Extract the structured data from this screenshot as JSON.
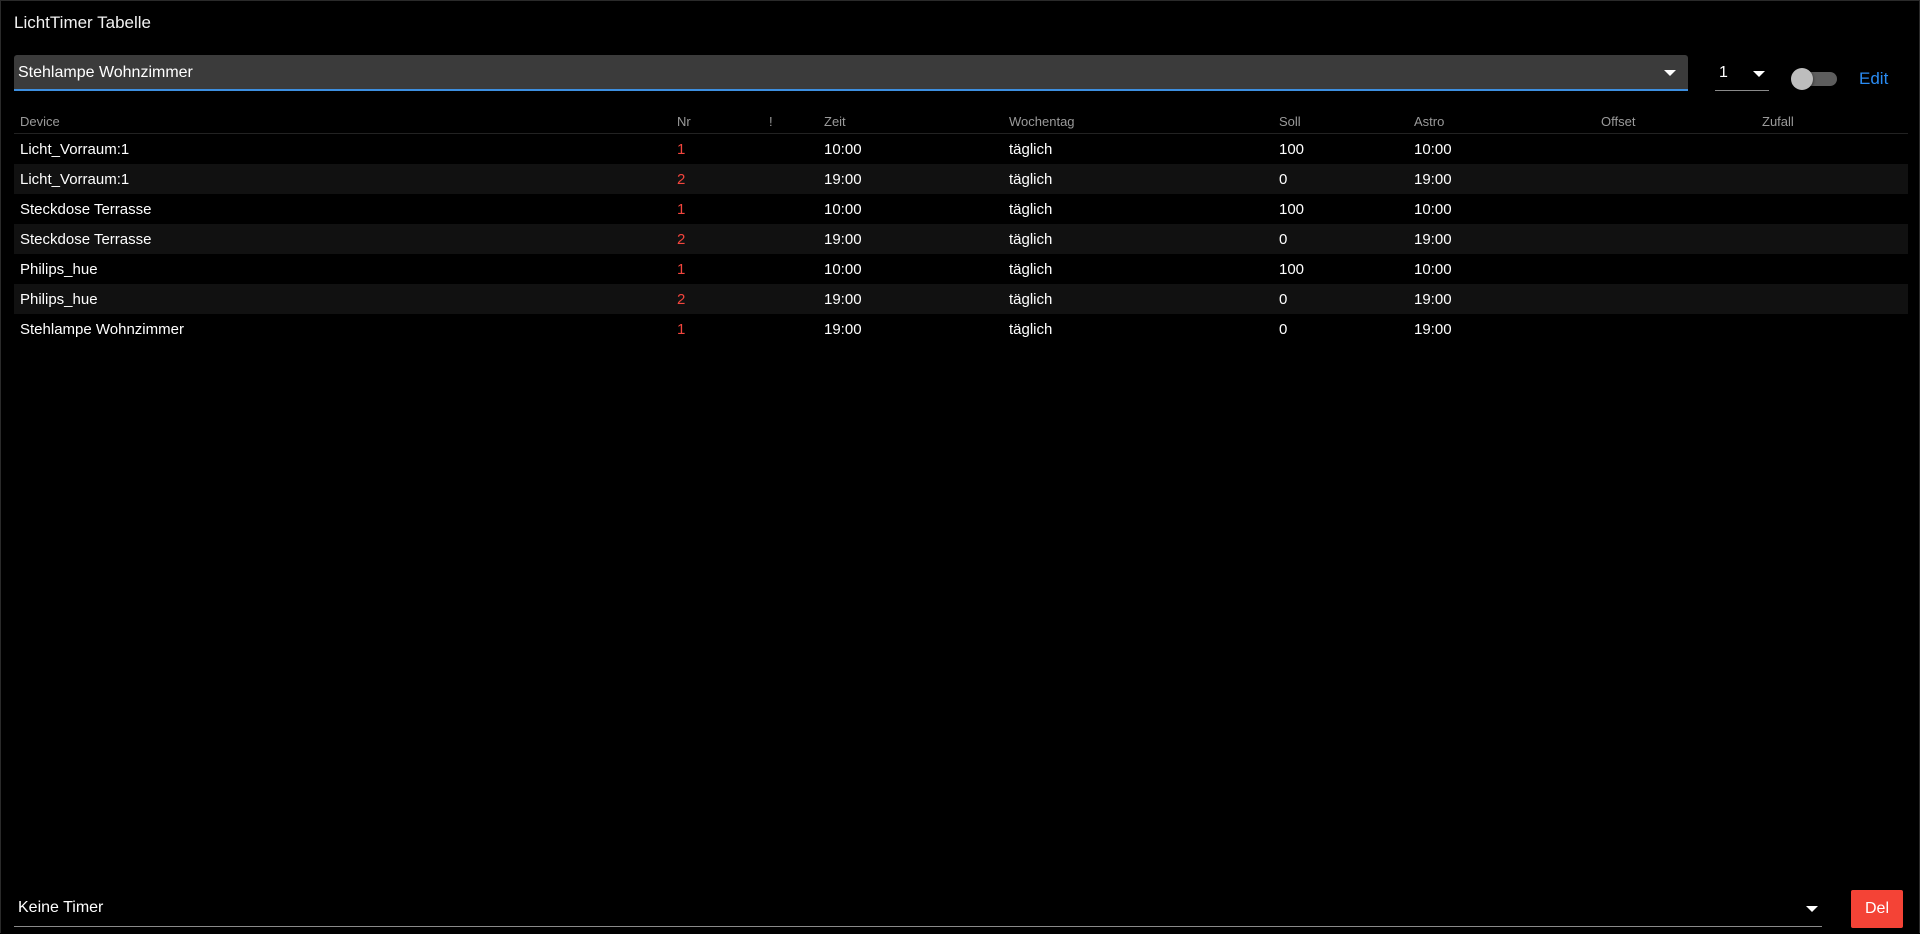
{
  "header": {
    "title": "LichtTimer Tabelle",
    "device_select_value": "Stehlampe Wohnzimmer",
    "number_select_value": "1",
    "edit_label": "Edit",
    "toggle_on": false
  },
  "table": {
    "columns": [
      "Device",
      "Nr",
      "!",
      "Zeit",
      "Wochentag",
      "Soll",
      "Astro",
      "Offset",
      "Zufall"
    ],
    "rows": [
      {
        "device": "Licht_Vorraum:1",
        "nr": "1",
        "excl": "",
        "zeit": "10:00",
        "wochentag": "täglich",
        "soll": "100",
        "astro": "10:00",
        "offset": "",
        "zufall": ""
      },
      {
        "device": "Licht_Vorraum:1",
        "nr": "2",
        "excl": "",
        "zeit": "19:00",
        "wochentag": "täglich",
        "soll": "0",
        "astro": "19:00",
        "offset": "",
        "zufall": ""
      },
      {
        "device": "Steckdose Terrasse",
        "nr": "1",
        "excl": "",
        "zeit": "10:00",
        "wochentag": "täglich",
        "soll": "100",
        "astro": "10:00",
        "offset": "",
        "zufall": ""
      },
      {
        "device": "Steckdose Terrasse",
        "nr": "2",
        "excl": "",
        "zeit": "19:00",
        "wochentag": "täglich",
        "soll": "0",
        "astro": "19:00",
        "offset": "",
        "zufall": ""
      },
      {
        "device": "Philips_hue",
        "nr": "1",
        "excl": "",
        "zeit": "10:00",
        "wochentag": "täglich",
        "soll": "100",
        "astro": "10:00",
        "offset": "",
        "zufall": ""
      },
      {
        "device": "Philips_hue",
        "nr": "2",
        "excl": "",
        "zeit": "19:00",
        "wochentag": "täglich",
        "soll": "0",
        "astro": "19:00",
        "offset": "",
        "zufall": ""
      },
      {
        "device": "Stehlampe Wohnzimmer",
        "nr": "1",
        "excl": "",
        "zeit": "19:00",
        "wochentag": "täglich",
        "soll": "0",
        "astro": "19:00",
        "offset": "",
        "zufall": ""
      }
    ]
  },
  "footer": {
    "timer_select_value": "Keine Timer",
    "del_label": "Del"
  },
  "colors": {
    "accent_blue": "#2a8cf4",
    "nr_red": "#f2453d",
    "del_red": "#f44336"
  }
}
